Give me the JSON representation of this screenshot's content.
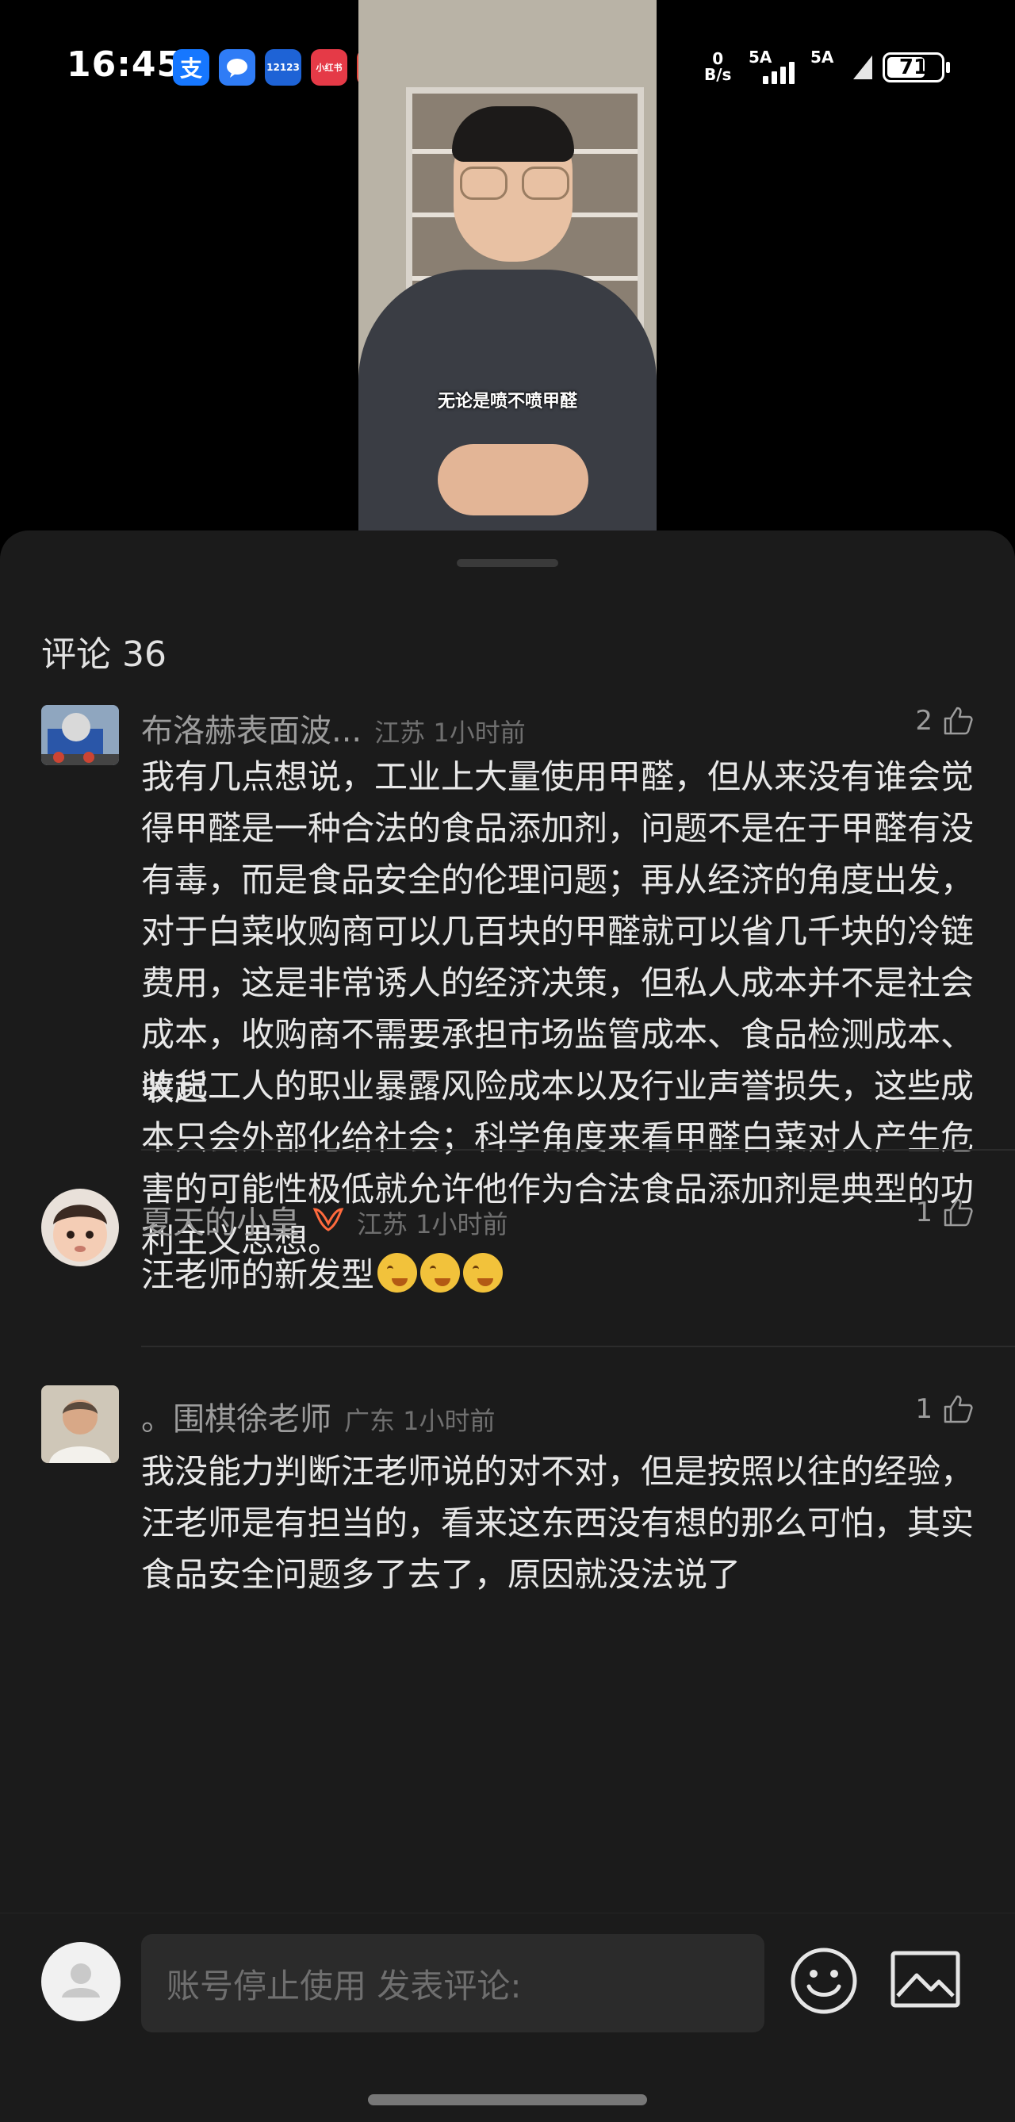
{
  "status_bar": {
    "time": "16:45",
    "app_icons": [
      "支",
      "",
      "12123",
      "小红书",
      "☎"
    ],
    "net_speed_value": "0",
    "net_speed_unit": "B/s",
    "signal1_label": "5A",
    "signal2_label": "5A",
    "battery": "71",
    "battery_level": 0.71
  },
  "video": {
    "caption": "无论是喷不喷甲醛"
  },
  "comments_panel": {
    "title": "评论 36",
    "comments": [
      {
        "name": "布洛赫表面波...",
        "location": "江苏 1小时前",
        "likes": "2",
        "text": "我有几点想说，工业上大量使用甲醛，但从来没有谁会觉得甲醛是一种合法的食品添加剂，问题不是在于甲醛有没有毒，而是食品安全的伦理问题；再从经济的角度出发，对于白菜收购商可以几百块的甲醛就可以省几千块的冷链费用，这是非常诱人的经济决策，但私人成本并不是社会成本，收购商不需要承担市场监管成本、食品检测成本、装货工人的职业暴露风险成本以及行业声誉损失，这些成本只会外部化给社会；科学角度来看甲醛白菜对人产生危害的可能性极低就允许他作为合法食品添加剂是典型的功利主义思想。",
        "collapse": "收起"
      },
      {
        "name": "夏天的小皇",
        "location": "江苏 1小时前",
        "likes": "1",
        "text": "汪老师的新发型"
      },
      {
        "name": "。围棋徐老师",
        "location": "广东 1小时前",
        "likes": "1",
        "text": "我没能力判断汪老师说的对不对，但是按照以往的经验，汪老师是有担当的，看来这东西没有想的那么可怕，其实食品安全问题多了去了，原因就没法说了"
      }
    ]
  },
  "bottom_bar": {
    "input_placeholder": "账号停止使用 发表评论:"
  },
  "icons": [
    "like-icon",
    "emoji-icon",
    "image-icon",
    "default-avatar-icon"
  ]
}
